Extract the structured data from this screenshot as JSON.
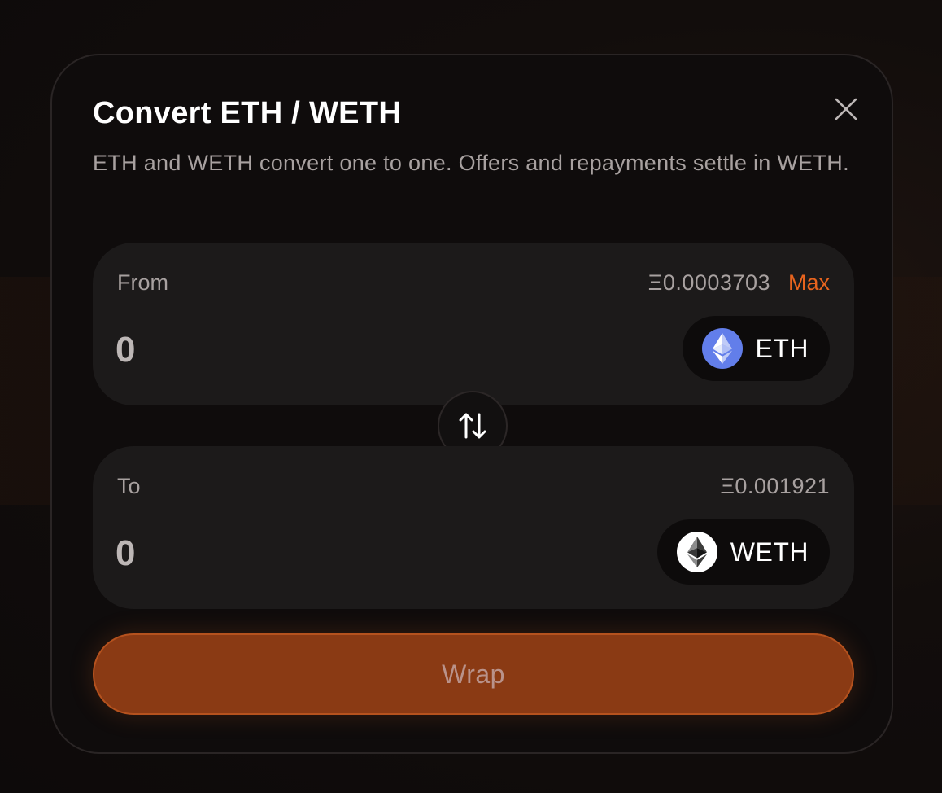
{
  "modal": {
    "title": "Convert ETH / WETH",
    "subtitle": "ETH and WETH convert one to one. Offers and repayments settle in WETH.",
    "close_icon": "close-icon"
  },
  "from": {
    "label": "From",
    "balance": "Ξ0.0003703",
    "max_label": "Max",
    "amount_placeholder": "0",
    "token": {
      "name": "ETH",
      "icon": "eth-icon",
      "icon_color": "#627eea"
    }
  },
  "swap": {
    "icon": "swap-arrows-icon"
  },
  "to": {
    "label": "To",
    "balance": "Ξ0.001921",
    "amount_placeholder": "0",
    "token": {
      "name": "WETH",
      "icon": "weth-icon",
      "icon_color": "#ffffff"
    }
  },
  "action": {
    "label": "Wrap"
  },
  "colors": {
    "accent": "#e8641e",
    "button_bg": "#8a3a14",
    "card_bg": "#1c1a1a",
    "modal_bg": "#0f0c0c"
  }
}
